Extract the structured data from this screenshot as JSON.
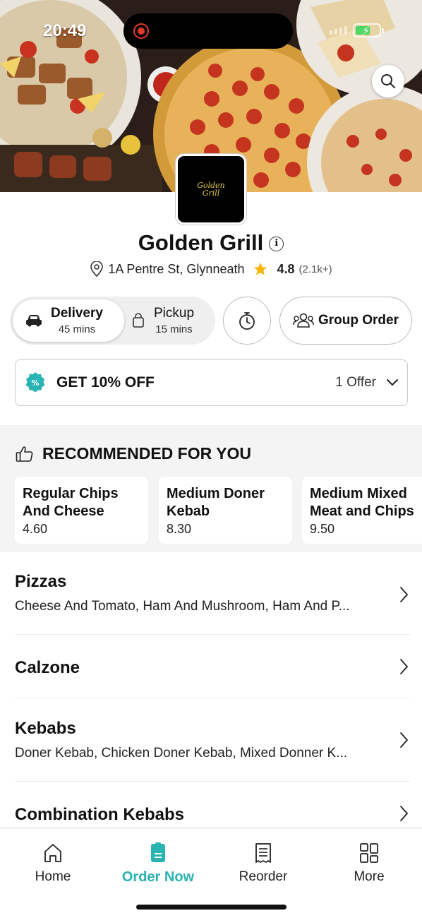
{
  "status_bar": {
    "time": "20:49"
  },
  "restaurant": {
    "logo_text_line1": "Golden",
    "logo_text_line2": "Grill",
    "name": "Golden Grill",
    "info_glyph": "i",
    "address": "1A Pentre St, Glynneath",
    "rating": "4.8",
    "rating_count": "(2.1k+)"
  },
  "order_mode": {
    "delivery": {
      "label": "Delivery",
      "time": "45 mins",
      "selected": true
    },
    "pickup": {
      "label": "Pickup",
      "time": "15 mins",
      "selected": false
    },
    "group_order_label": "Group Order"
  },
  "offer": {
    "title": "GET 10% OFF",
    "count": "1 Offer",
    "badge_glyph": "%"
  },
  "recommended": {
    "title": "RECOMMENDED FOR YOU",
    "items": [
      {
        "name_line1": "Regular Chips",
        "name_line2": "And Cheese",
        "price": "4.60"
      },
      {
        "name_line1": "Medium Doner",
        "name_line2": "Kebab",
        "price": "8.30"
      },
      {
        "name_line1": "Medium Mixed",
        "name_line2": "Meat and Chips",
        "price": "9.50"
      }
    ]
  },
  "categories": [
    {
      "name": "Pizzas",
      "desc": "Cheese And Tomato, Ham And Mushroom, Ham And P..."
    },
    {
      "name": "Calzone",
      "desc": ""
    },
    {
      "name": "Kebabs",
      "desc": "Doner Kebab, Chicken Doner Kebab, Mixed Donner K..."
    },
    {
      "name": "Combination Kebabs",
      "desc": ""
    }
  ],
  "tabbar": {
    "items": [
      {
        "label": "Home",
        "icon": "home-icon"
      },
      {
        "label": "Order Now",
        "icon": "order-icon",
        "active": true
      },
      {
        "label": "Reorder",
        "icon": "receipt-icon"
      },
      {
        "label": "More",
        "icon": "grid-icon"
      }
    ]
  },
  "colors": {
    "accent": "#2ab3b3",
    "star": "#f4b400",
    "record": "#e23b2c",
    "battery": "#4cd964"
  }
}
